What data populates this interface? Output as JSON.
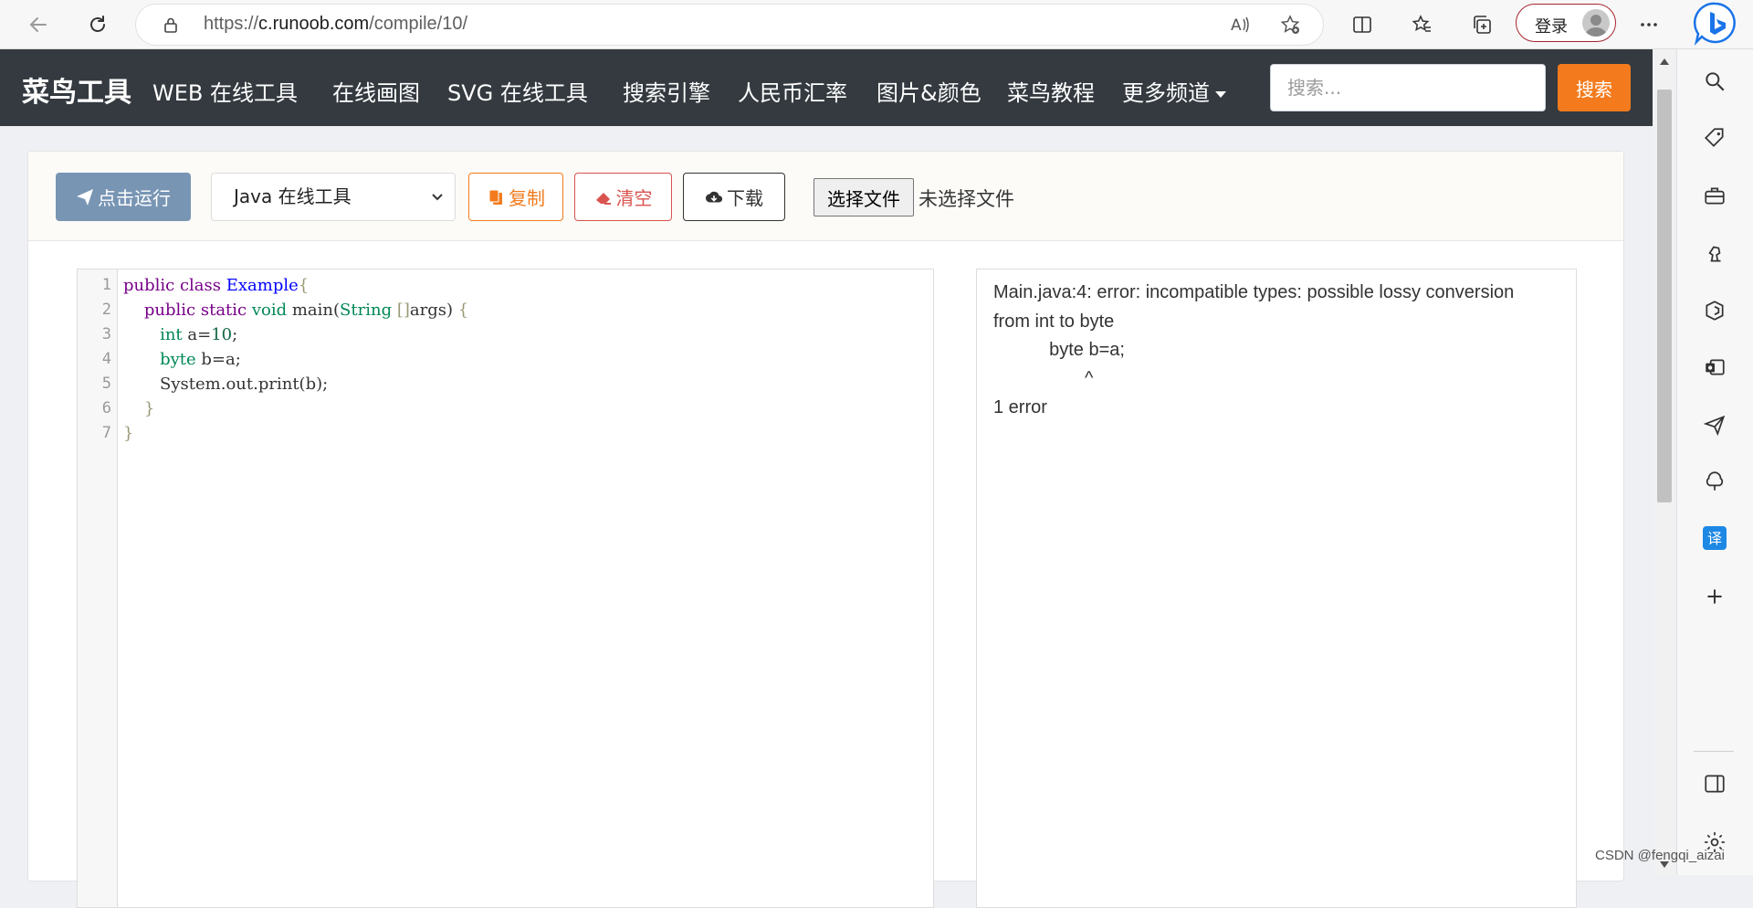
{
  "browser": {
    "url_prefix": "https://",
    "url_host": "c.runoob.com",
    "url_path": "/compile/10/",
    "login_label": "登录"
  },
  "navbar": {
    "brand": "菜鸟工具",
    "items": [
      "WEB 在线工具",
      "在线画图",
      "SVG 在线工具",
      "搜索引擎",
      "人民币汇率",
      "图片&颜色",
      "菜鸟教程",
      "更多频道"
    ],
    "search_placeholder": "搜索...",
    "search_button": "搜索"
  },
  "toolbar": {
    "run_label": "点击运行",
    "language_selected": "Java 在线工具",
    "copy_label": "复制",
    "clear_label": "清空",
    "download_label": "下载",
    "file_button_label": "选择文件",
    "file_status": "未选择文件"
  },
  "editor": {
    "line_numbers": [
      "1",
      "2",
      "3",
      "4",
      "5",
      "6",
      "7"
    ]
  },
  "output": {
    "lines": [
      "Main.java:4: error: incompatible types: possible lossy conversion",
      "from int to byte",
      "           byte b=a;",
      "                  ^",
      "1 error"
    ]
  },
  "watermark": "CSDN @fengqi_aizai",
  "colors": {
    "navbar_bg": "#343a40",
    "accent_orange": "#f37b1d",
    "run_button": "#7895b4",
    "danger": "#d9534f"
  },
  "icons": {
    "back": "arrow-left-icon",
    "refresh": "refresh-icon",
    "lock": "lock-icon",
    "read_aloud": "read-aloud-icon",
    "favorite": "star-plus-icon",
    "split": "split-screen-icon",
    "favorites": "favorites-icon",
    "collections": "collections-icon",
    "more": "more-icon",
    "bing": "bing-chat-icon",
    "run": "paper-plane-icon",
    "copy": "copy-icon",
    "clear": "eraser-icon",
    "download": "cloud-download-icon"
  }
}
